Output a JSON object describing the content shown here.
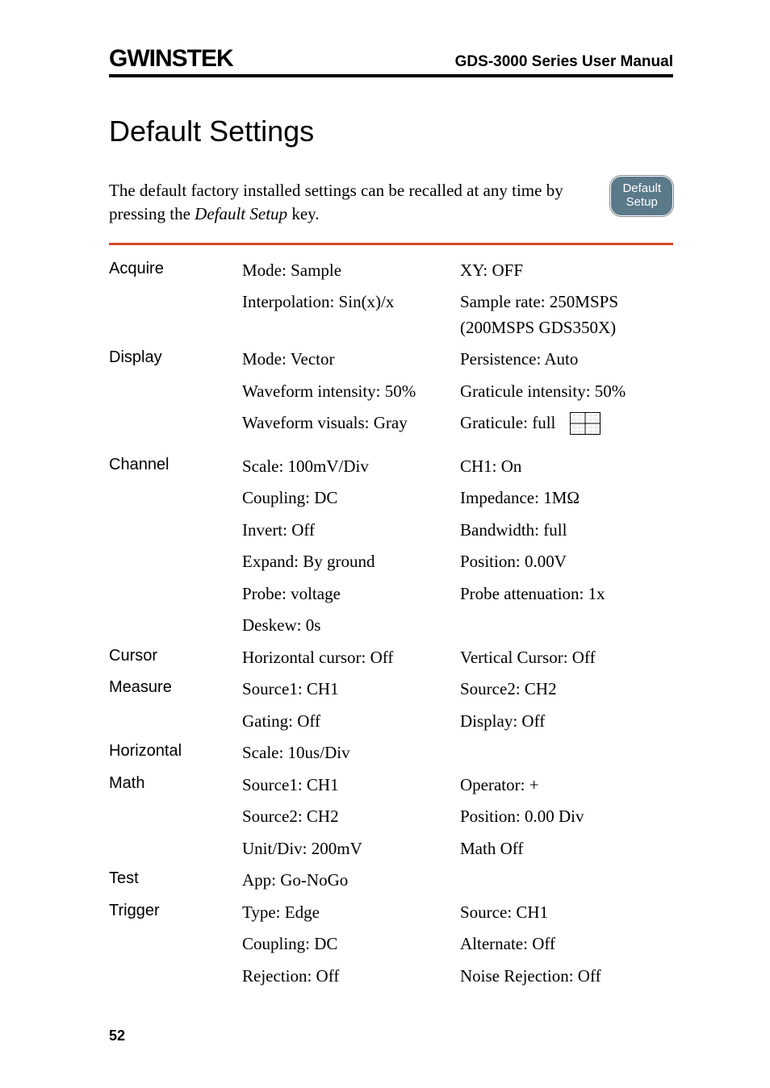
{
  "header": {
    "logo": "GWINSTEK",
    "manual": "GDS-3000 Series User Manual"
  },
  "title": "Default Settings",
  "intro": {
    "pre": "The default factory installed settings can be recalled at any time by pressing the ",
    "italic": "Default Setup",
    "post": " key."
  },
  "button": {
    "line1": "Default",
    "line2": "Setup"
  },
  "settings": {
    "acquire": {
      "label": "Acquire",
      "r1a": "Mode: Sample",
      "r1b": "XY: OFF",
      "r2a": "Interpolation: Sin(x)/x",
      "r2b": "Sample rate: 250MSPS (200MSPS GDS350X)"
    },
    "display": {
      "label": "Display",
      "r1a": "Mode: Vector",
      "r1b": "Persistence: Auto",
      "r2a": "Waveform intensity: 50%",
      "r2b": "Graticule intensity: 50%",
      "r3a": "Waveform visuals: Gray",
      "r3b": "Graticule: full"
    },
    "channel": {
      "label": "Channel",
      "r1a": "Scale: 100mV/Div",
      "r1b": "CH1: On",
      "r2a": "Coupling: DC",
      "r2b": "Impedance: 1MΩ",
      "r3a": "Invert: Off",
      "r3b": "Bandwidth: full",
      "r4a": "Expand: By ground",
      "r4b": "Position: 0.00V",
      "r5a": "Probe: voltage",
      "r5b": "Probe attenuation: 1x",
      "r6a": "Deskew: 0s"
    },
    "cursor": {
      "label": "Cursor",
      "r1a": "Horizontal cursor: Off",
      "r1b": "Vertical Cursor: Off"
    },
    "measure": {
      "label": "Measure",
      "r1a": "Source1: CH1",
      "r1b": "Source2: CH2",
      "r2a": "Gating: Off",
      "r2b": "Display: Off"
    },
    "horizontal": {
      "label": "Horizontal",
      "r1a": "Scale: 10us/Div"
    },
    "math": {
      "label": "Math",
      "r1a": "Source1: CH1",
      "r1b": "Operator: +",
      "r2a": "Source2: CH2",
      "r2b": "Position: 0.00 Div",
      "r3a": "Unit/Div: 200mV",
      "r3b": "Math Off"
    },
    "test": {
      "label": "Test",
      "r1a": "App: Go-NoGo"
    },
    "trigger": {
      "label": "Trigger",
      "r1a": "Type: Edge",
      "r1b": "Source: CH1",
      "r2a": "Coupling: DC",
      "r2b": "Alternate: Off",
      "r3a": "Rejection: Off",
      "r3b": "Noise Rejection: Off"
    }
  },
  "page": "52"
}
